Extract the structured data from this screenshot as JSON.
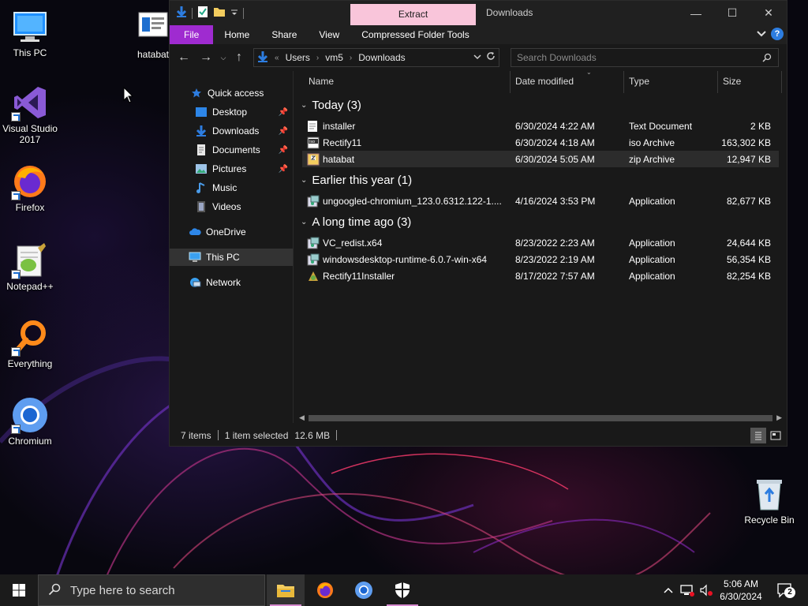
{
  "desktop": {
    "icons": [
      {
        "label": "This PC"
      },
      {
        "label": "hatabat"
      },
      {
        "label": "Visual Studio 2017"
      },
      {
        "label": "Firefox"
      },
      {
        "label": "Notepad++"
      },
      {
        "label": "Everything"
      },
      {
        "label": "Chromium"
      },
      {
        "label": "Recycle Bin"
      }
    ]
  },
  "window": {
    "title": "Downloads",
    "context_tab": "Extract",
    "ribbon_tabs": [
      "File",
      "Home",
      "Share",
      "View",
      "Compressed Folder Tools"
    ],
    "address": {
      "crumbs": [
        "Users",
        "vm5",
        "Downloads"
      ]
    },
    "search": {
      "placeholder": "Search Downloads"
    },
    "nav": {
      "quick_access": "Quick access",
      "items": [
        "Desktop",
        "Downloads",
        "Documents",
        "Pictures",
        "Music",
        "Videos"
      ],
      "onedrive": "OneDrive",
      "this_pc": "This PC",
      "network": "Network"
    },
    "columns": [
      "Name",
      "Date modified",
      "Type",
      "Size"
    ],
    "groups": [
      {
        "label": "Today (3)",
        "files": [
          {
            "name": "installer",
            "date": "6/30/2024 4:22 AM",
            "type": "Text Document",
            "size": "2 KB",
            "icon": "text-file-icon"
          },
          {
            "name": "Rectify11",
            "date": "6/30/2024 4:18 AM",
            "type": "iso Archive",
            "size": "163,302 KB",
            "icon": "iso-archive-icon"
          },
          {
            "name": "hatabat",
            "date": "6/30/2024 5:05 AM",
            "type": "zip Archive",
            "size": "12,947 KB",
            "icon": "zip-archive-icon"
          }
        ]
      },
      {
        "label": "Earlier this year (1)",
        "files": [
          {
            "name": "ungoogled-chromium_123.0.6312.122-1....",
            "date": "4/16/2024 3:53 PM",
            "type": "Application",
            "size": "82,677 KB",
            "icon": "installer-app-icon"
          }
        ]
      },
      {
        "label": "A long time ago (3)",
        "files": [
          {
            "name": "VC_redist.x64",
            "date": "8/23/2022 2:23 AM",
            "type": "Application",
            "size": "24,644 KB",
            "icon": "installer-app-icon"
          },
          {
            "name": "windowsdesktop-runtime-6.0.7-win-x64",
            "date": "8/23/2022 2:19 AM",
            "type": "Application",
            "size": "56,354 KB",
            "icon": "installer-app-icon"
          },
          {
            "name": "Rectify11Installer",
            "date": "8/17/2022 7:57 AM",
            "type": "Application",
            "size": "82,254 KB",
            "icon": "installer-app-icon"
          }
        ]
      }
    ],
    "status": {
      "items": "7 items",
      "selected": "1 item selected",
      "size": "12.6 MB"
    }
  },
  "taskbar": {
    "search_placeholder": "Type here to search",
    "time": "5:06 AM",
    "date": "6/30/2024",
    "notification_count": "2"
  },
  "colors": {
    "file_tab": "#9f2bd0",
    "context_tab": "#f9c5da",
    "accent_blue": "#2d7de0"
  }
}
